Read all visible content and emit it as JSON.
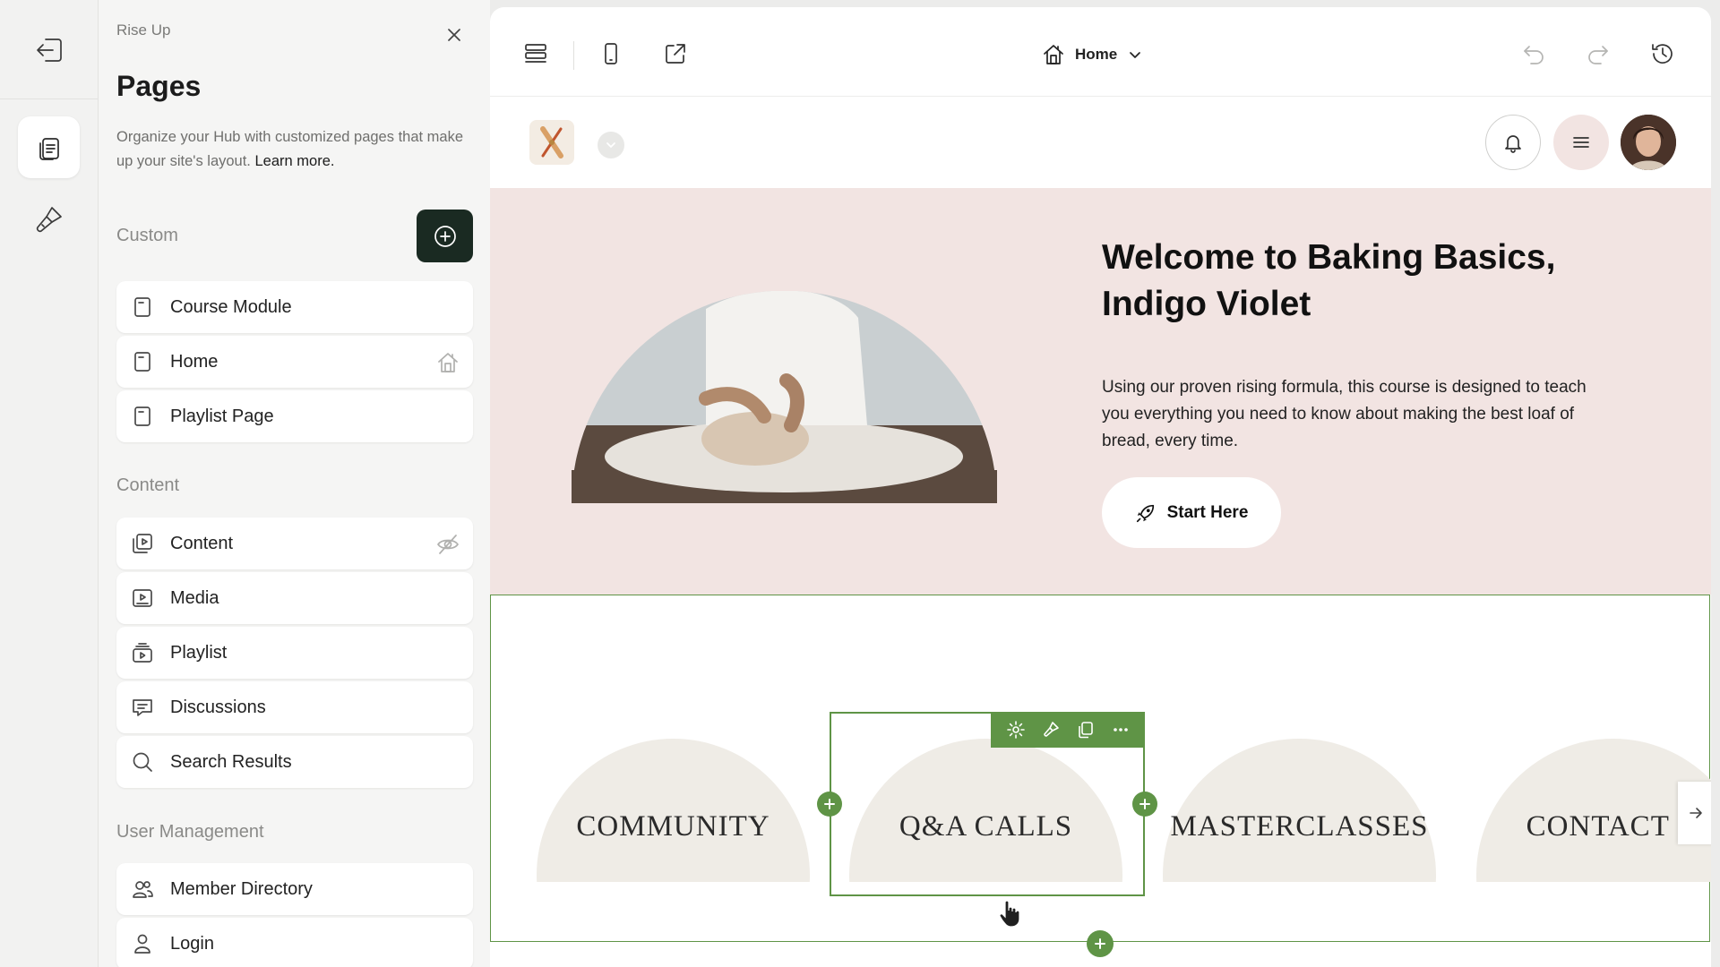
{
  "panel": {
    "brand": "Rise Up",
    "title": "Pages",
    "description": "Organize your Hub with customized pages that make up your site's layout.",
    "learn_more": "Learn more.",
    "sections": {
      "custom": "Custom",
      "content": "Content",
      "user_management": "User Management"
    },
    "custom_pages": [
      {
        "label": "Course Module",
        "icon": "page-icon"
      },
      {
        "label": "Home",
        "icon": "page-icon",
        "trail": "home-icon"
      },
      {
        "label": "Playlist Page",
        "icon": "page-icon"
      }
    ],
    "content_pages": [
      {
        "label": "Content",
        "icon": "content-icon",
        "trail": "hidden-eye-icon"
      },
      {
        "label": "Media",
        "icon": "media-icon"
      },
      {
        "label": "Playlist",
        "icon": "playlist-icon"
      },
      {
        "label": "Discussions",
        "icon": "discussions-icon"
      },
      {
        "label": "Search Results",
        "icon": "search-icon"
      }
    ],
    "user_pages": [
      {
        "label": "Member Directory",
        "icon": "members-icon"
      },
      {
        "label": "Login",
        "icon": "user-icon"
      }
    ]
  },
  "toolbar": {
    "current_page": "Home"
  },
  "hero": {
    "title": "Welcome to Baking Basics, Indigo Violet",
    "text": "Using our proven rising formula, this course is designed to teach you everything you need to know about making the best loaf of bread, every time.",
    "cta": "Start Here"
  },
  "categories": [
    {
      "label": "COMMUNITY"
    },
    {
      "label": "Q&A CALLS"
    },
    {
      "label": "MASTERCLASSES"
    },
    {
      "label": "CONTACT U"
    }
  ],
  "colors": {
    "accent_green": "#5f9446",
    "hero_bg": "#f2e4e2",
    "add_button_bg": "#1a2a22",
    "card_arch": "#efece6"
  }
}
